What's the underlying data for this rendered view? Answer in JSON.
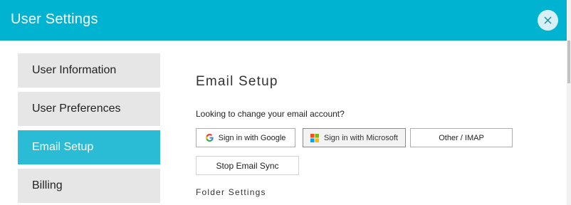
{
  "header": {
    "title": "User Settings",
    "close_icon": "close-icon"
  },
  "sidebar": {
    "items": [
      {
        "label": "User Information",
        "active": false
      },
      {
        "label": "User Preferences",
        "active": false
      },
      {
        "label": "Email Setup",
        "active": true
      },
      {
        "label": "Billing",
        "active": false
      }
    ]
  },
  "email_setup": {
    "title": "Email Setup",
    "prompt": "Looking to change your email account?",
    "buttons": {
      "google": {
        "label": "Sign in with Google",
        "icon": "google-icon"
      },
      "microsoft": {
        "label": "Sign in with Microsoft",
        "icon": "microsoft-icon"
      },
      "imap": {
        "label": "Other / IMAP"
      },
      "stop_sync": {
        "label": "Stop Email Sync"
      }
    },
    "folder_settings_title": "Folder Settings"
  },
  "colors": {
    "header_bg": "#00b3d1",
    "active_item_bg": "#2bbcd5",
    "inactive_item_bg": "#e6e6e6"
  }
}
